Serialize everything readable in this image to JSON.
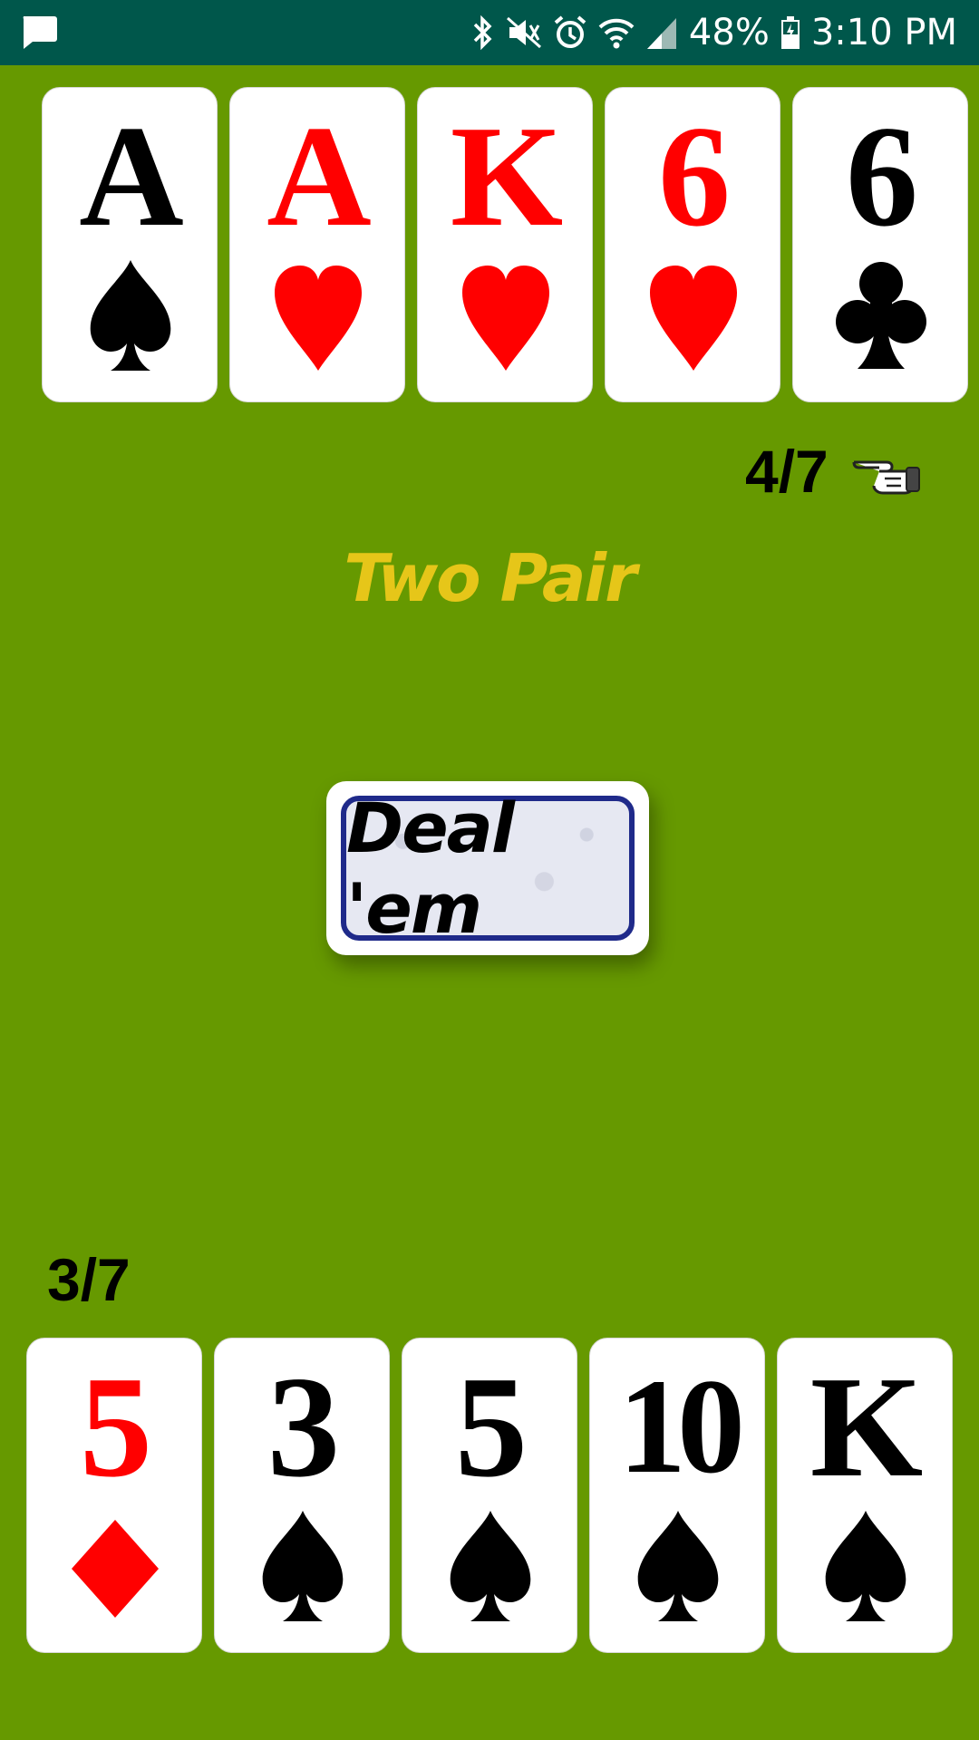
{
  "status_bar": {
    "battery": "48%",
    "time": "3:10 PM",
    "icons": [
      "message-icon",
      "bluetooth-icon",
      "mute-vibrate-icon",
      "alarm-icon",
      "wifi-icon",
      "signal-icon",
      "battery-icon"
    ]
  },
  "top_hand": {
    "counter": "4/7",
    "cards": [
      {
        "rank": "A",
        "suit": "spade"
      },
      {
        "rank": "A",
        "suit": "heart"
      },
      {
        "rank": "K",
        "suit": "heart"
      },
      {
        "rank": "6",
        "suit": "heart"
      },
      {
        "rank": "6",
        "suit": "club"
      }
    ]
  },
  "hand_result": "Two Pair",
  "deal_button": {
    "label": "Deal 'em"
  },
  "bottom_hand": {
    "counter": "3/7",
    "cards": [
      {
        "rank": "5",
        "suit": "diamond"
      },
      {
        "rank": "3",
        "suit": "spade"
      },
      {
        "rank": "5",
        "suit": "spade"
      },
      {
        "rank": "10",
        "suit": "spade"
      },
      {
        "rank": "K",
        "suit": "spade"
      }
    ]
  },
  "colors": {
    "table": "#669900",
    "status_bar": "#00574b",
    "red_suit": "#ff0000",
    "hand_result": "#e6c619",
    "button_border": "#1f2a8a"
  }
}
